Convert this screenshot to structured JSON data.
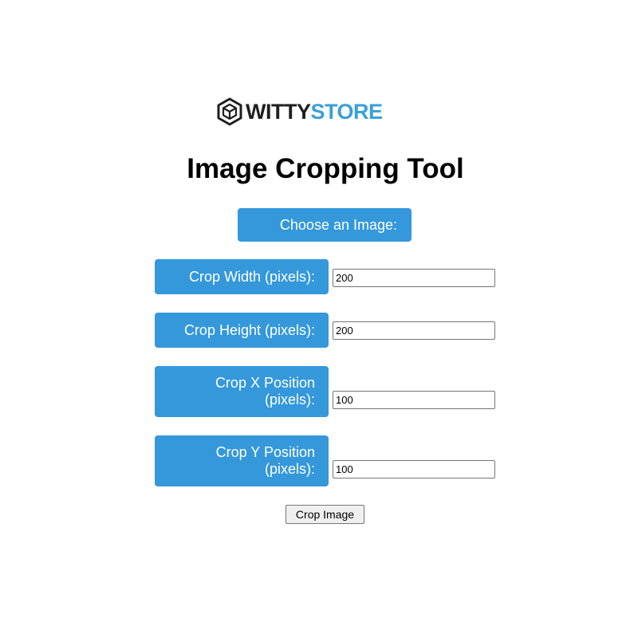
{
  "logo": {
    "text_part1": "WITTY",
    "text_part2": "STORE",
    "icon": "cube-icon",
    "colors": {
      "dark": "#1f1f1f",
      "accent": "#3aa0d8"
    }
  },
  "title": "Image Cropping Tool",
  "choose_image_label": "Choose an Image:",
  "fields": {
    "width": {
      "label": "Crop Width (pixels):",
      "value": "200"
    },
    "height": {
      "label": "Crop Height (pixels):",
      "value": "200"
    },
    "x": {
      "label_line1": "Crop X Position",
      "label_line2": "(pixels):",
      "value": "100"
    },
    "y": {
      "label_line1": "Crop Y Position",
      "label_line2": "(pixels):",
      "value": "100"
    }
  },
  "crop_button_label": "Crop Image",
  "colors": {
    "label_background": "#3498db",
    "label_text": "#ffffff",
    "background": "#ffffff"
  }
}
